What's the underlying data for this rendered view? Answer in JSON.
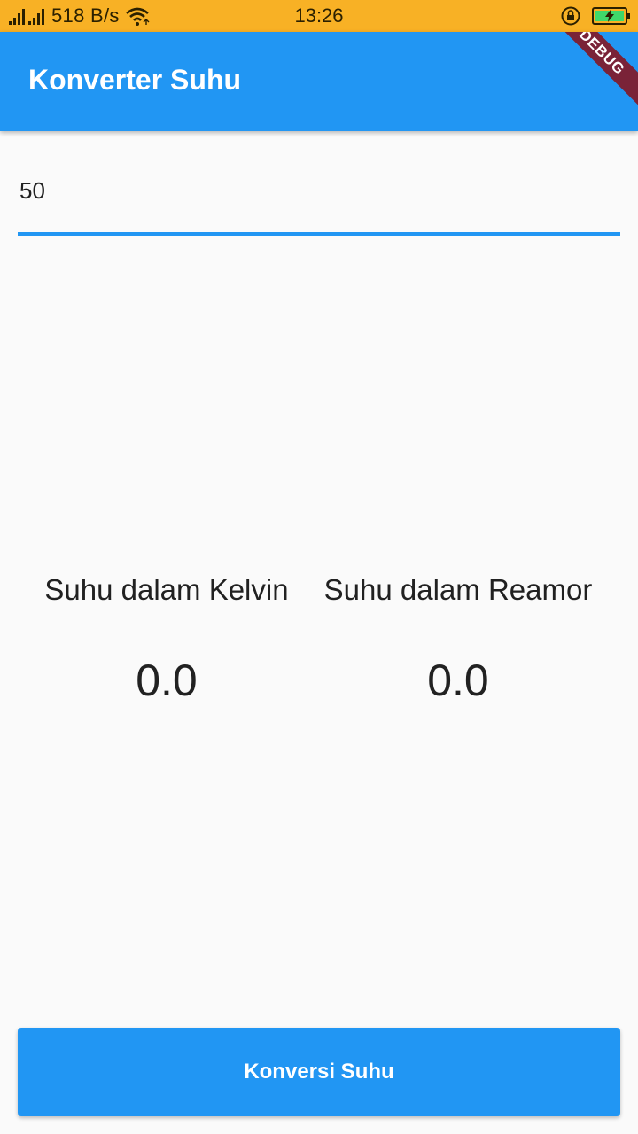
{
  "status_bar": {
    "net_speed": "518 B/s",
    "time": "13:26",
    "icons": [
      "signal-icon",
      "signal-icon",
      "wifi-icon",
      "rotation-lock-icon",
      "battery-charging-icon"
    ],
    "background": "#f8b125"
  },
  "app_bar": {
    "title": "Konverter Suhu",
    "debug_banner": "DEBUG",
    "background": "#2196f3"
  },
  "input": {
    "value": "50",
    "accent": "#2196f3"
  },
  "results": {
    "kelvin": {
      "label": "Suhu dalam Kelvin",
      "value": "0.0"
    },
    "reamor": {
      "label": "Suhu dalam Reamor",
      "value": "0.0"
    }
  },
  "convert_button": {
    "label": "Konversi Suhu",
    "background": "#2196f3"
  }
}
